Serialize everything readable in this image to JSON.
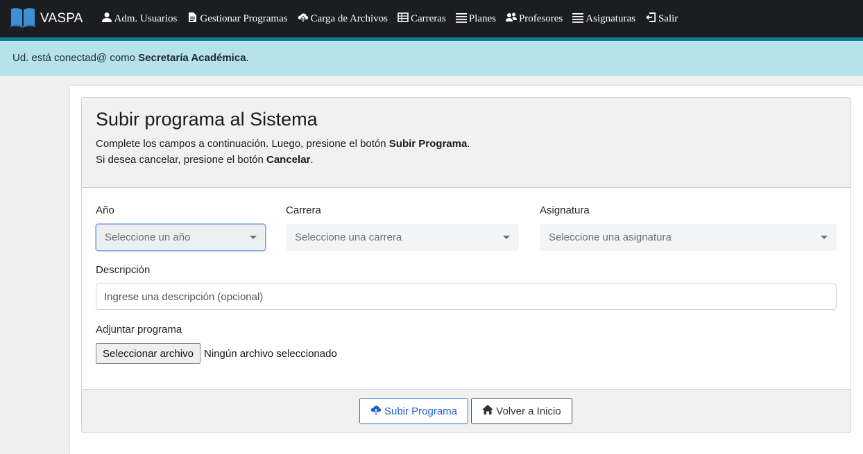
{
  "brand": {
    "name": "VASPA",
    "icon": "book-icon"
  },
  "nav": [
    {
      "label": "Adm. Usuarios",
      "icon": "user-icon"
    },
    {
      "label": "Gestionar Programas",
      "icon": "file-icon"
    },
    {
      "label": "Carga de Archivos",
      "icon": "cloud-upload-icon"
    },
    {
      "label": "Carreras",
      "icon": "table-icon"
    },
    {
      "label": "Planes",
      "icon": "list-icon"
    },
    {
      "label": "Profesores",
      "icon": "users-icon"
    },
    {
      "label": "Asignaturas",
      "icon": "list-icon"
    },
    {
      "label": "Salir",
      "icon": "logout-icon"
    }
  ],
  "alert": {
    "prefix": "Ud. está conectad@ como ",
    "role": "Secretaría Académica",
    "suffix": "."
  },
  "card": {
    "title": "Subir programa al Sistema",
    "line1_prefix": "Complete los campos a continuación. Luego, presione el botón ",
    "line1_bold": "Subir Programa",
    "line1_suffix": ".",
    "line2_prefix": "Si desea cancelar, presione el botón ",
    "line2_bold": "Cancelar",
    "line2_suffix": "."
  },
  "form": {
    "year": {
      "label": "Año",
      "placeholder": "Seleccione un año"
    },
    "career": {
      "label": "Carrera",
      "placeholder": "Seleccione una carrera"
    },
    "subject": {
      "label": "Asignatura",
      "placeholder": "Seleccione una asignatura"
    },
    "description": {
      "label": "Descripción",
      "placeholder": "Ingrese una descripción (opcional)"
    },
    "attachment": {
      "label": "Adjuntar programa",
      "button": "Seleccionar archivo",
      "status": "Ningún archivo seleccionado"
    }
  },
  "footer": {
    "submit_label": "Subir Programa",
    "home_label": "Volver a Inicio"
  },
  "colors": {
    "navbar": "#1b1d20",
    "navbar_accent": "#127d95",
    "alert_bg": "#b6e2ea",
    "primary": "#1d5fd0"
  }
}
